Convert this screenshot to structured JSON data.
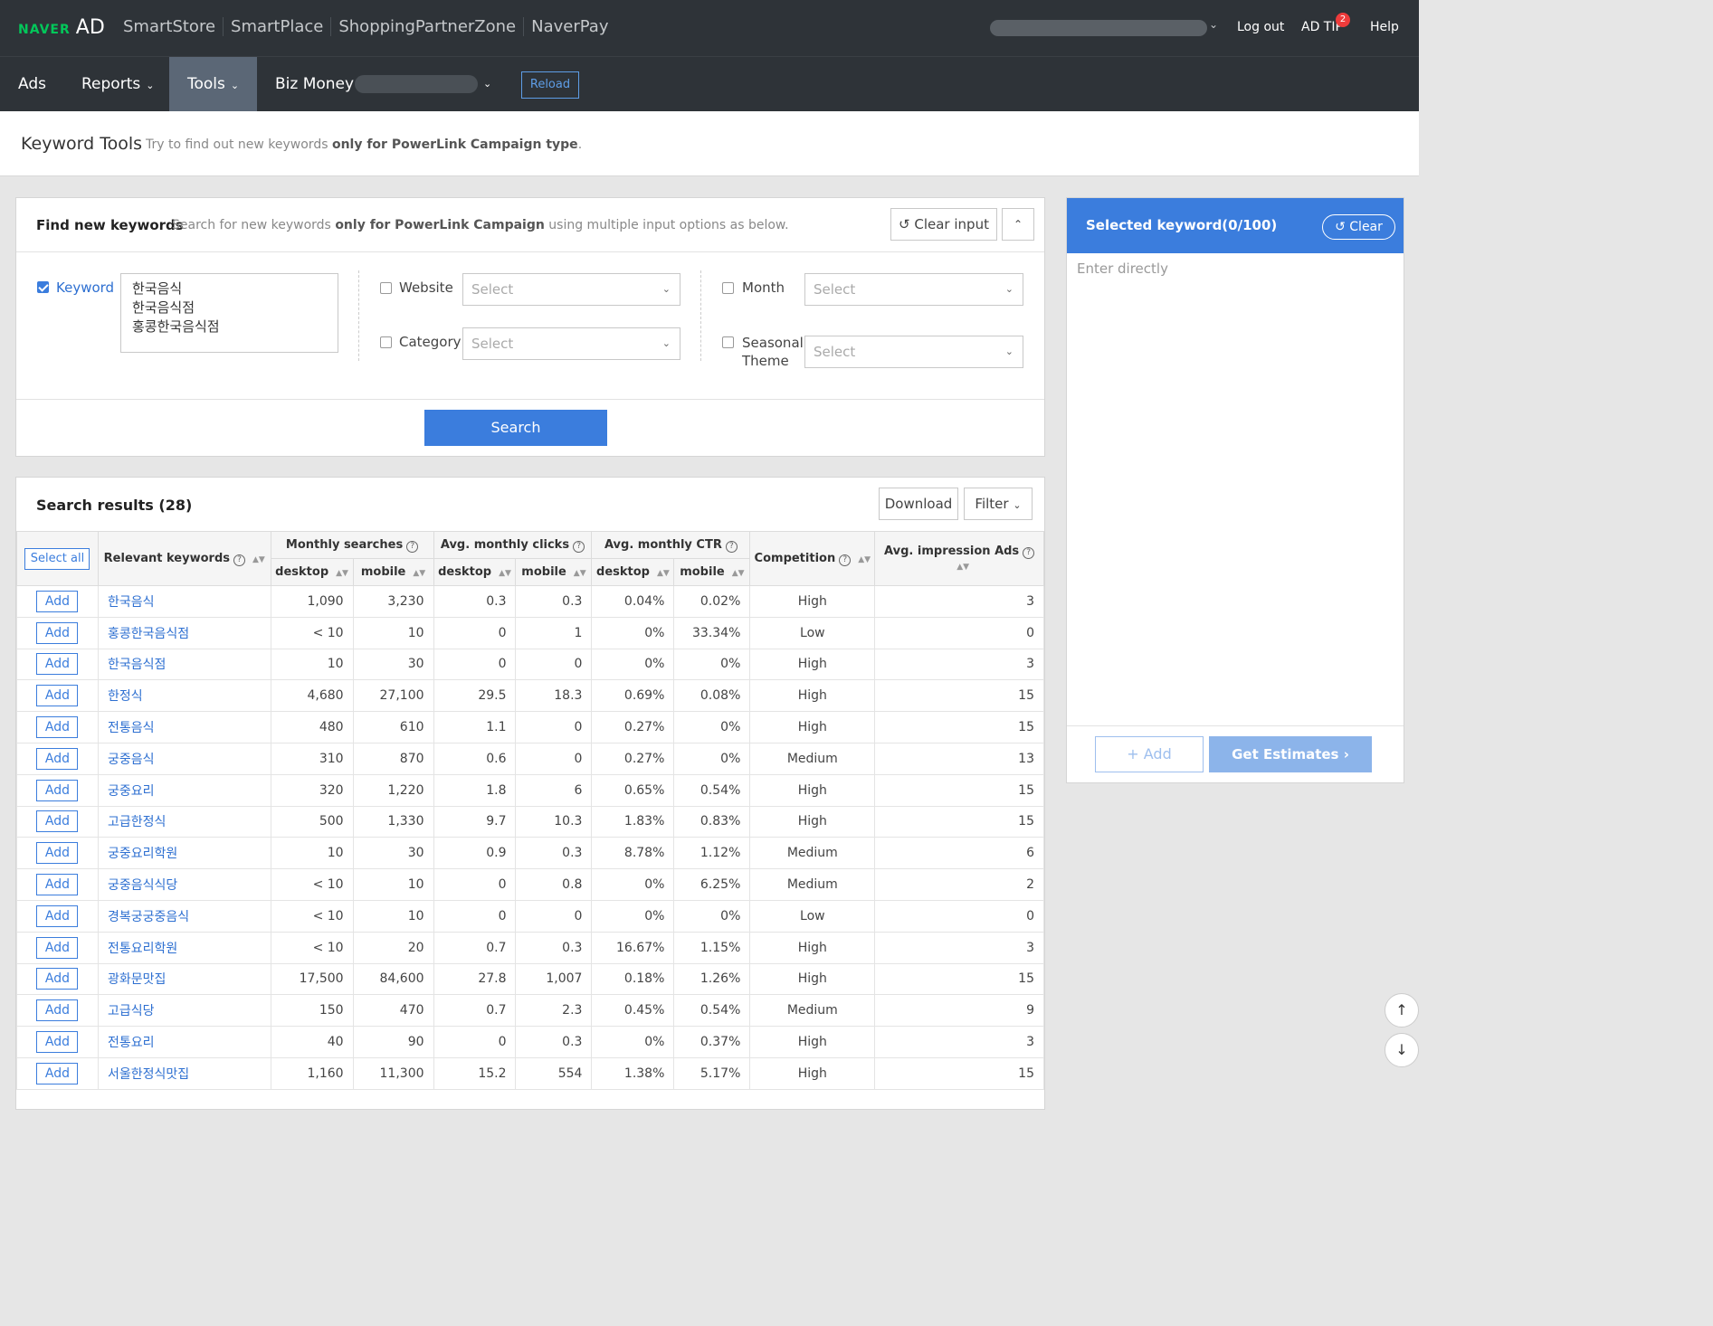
{
  "brand": {
    "naver": "NAVER",
    "ad": "AD"
  },
  "top_links": [
    "SmartStore",
    "SmartPlace",
    "ShoppingPartnerZone",
    "NaverPay"
  ],
  "top_right": {
    "logout": "Log out",
    "adtip": "AD TIP",
    "adtip_badge": "2",
    "help": "Help"
  },
  "nav": {
    "ads": "Ads",
    "reports": "Reports",
    "tools": "Tools",
    "bizmoney": "Biz Money",
    "reload": "Reload"
  },
  "page_title": {
    "title": "Keyword Tools",
    "desc_pre": "Try to find out new keywords ",
    "desc_bold": "only for PowerLink Campaign type",
    "desc_post": "."
  },
  "find": {
    "title": "Find new keywords",
    "desc_pre": "Search for new keywords ",
    "desc_bold": "only for PowerLink Campaign",
    "desc_post": " using multiple input options as below.",
    "clear_input": "Clear input",
    "keyword_label": "Keyword",
    "keyword_checked": true,
    "keywords": [
      "한국음식",
      "한국음식점",
      "홍콩한국음식점"
    ],
    "website_label": "Website",
    "category_label": "Category",
    "month_label": "Month",
    "seasonal_label_1": "Seasonal",
    "seasonal_label_2": "Theme",
    "select_placeholder": "Select",
    "search_button": "Search"
  },
  "results": {
    "title": "Search results (28)",
    "download": "Download",
    "filter": "Filter",
    "select_all": "Select all",
    "add_label": "Add",
    "headers": {
      "relevant": "Relevant keywords",
      "monthly": "Monthly searches",
      "clicks": "Avg. monthly clicks",
      "ctr": "Avg. monthly CTR",
      "competition": "Competition",
      "impression": "Avg. impression Ads",
      "desktop": "desktop",
      "mobile": "mobile"
    },
    "rows": [
      [
        "한국음식",
        "1,090",
        "3,230",
        "0.3",
        "0.3",
        "0.04%",
        "0.02%",
        "High",
        "3"
      ],
      [
        "홍콩한국음식점",
        "< 10",
        "10",
        "0",
        "1",
        "0%",
        "33.34%",
        "Low",
        "0"
      ],
      [
        "한국음식점",
        "10",
        "30",
        "0",
        "0",
        "0%",
        "0%",
        "High",
        "3"
      ],
      [
        "한정식",
        "4,680",
        "27,100",
        "29.5",
        "18.3",
        "0.69%",
        "0.08%",
        "High",
        "15"
      ],
      [
        "전통음식",
        "480",
        "610",
        "1.1",
        "0",
        "0.27%",
        "0%",
        "High",
        "15"
      ],
      [
        "궁중음식",
        "310",
        "870",
        "0.6",
        "0",
        "0.27%",
        "0%",
        "Medium",
        "13"
      ],
      [
        "궁중요리",
        "320",
        "1,220",
        "1.8",
        "6",
        "0.65%",
        "0.54%",
        "High",
        "15"
      ],
      [
        "고급한정식",
        "500",
        "1,330",
        "9.7",
        "10.3",
        "1.83%",
        "0.83%",
        "High",
        "15"
      ],
      [
        "궁중요리학원",
        "10",
        "30",
        "0.9",
        "0.3",
        "8.78%",
        "1.12%",
        "Medium",
        "6"
      ],
      [
        "궁중음식식당",
        "< 10",
        "10",
        "0",
        "0.8",
        "0%",
        "6.25%",
        "Medium",
        "2"
      ],
      [
        "경복궁궁중음식",
        "< 10",
        "10",
        "0",
        "0",
        "0%",
        "0%",
        "Low",
        "0"
      ],
      [
        "전통요리학원",
        "< 10",
        "20",
        "0.7",
        "0.3",
        "16.67%",
        "1.15%",
        "High",
        "3"
      ],
      [
        "광화문맛집",
        "17,500",
        "84,600",
        "27.8",
        "1,007",
        "0.18%",
        "1.26%",
        "High",
        "15"
      ],
      [
        "고급식당",
        "150",
        "470",
        "0.7",
        "2.3",
        "0.45%",
        "0.54%",
        "Medium",
        "9"
      ],
      [
        "전통요리",
        "40",
        "90",
        "0",
        "0.3",
        "0%",
        "0.37%",
        "High",
        "3"
      ],
      [
        "서울한정식맛집",
        "1,160",
        "11,300",
        "15.2",
        "554",
        "1.38%",
        "5.17%",
        "High",
        "15"
      ]
    ]
  },
  "selected": {
    "title": "Selected keyword(0/100)",
    "clear": "Clear",
    "placeholder": "Enter directly",
    "add": "Add",
    "estimates": "Get Estimates"
  },
  "colors": {
    "topbar": "#2e3338",
    "accent": "#3b7ddd",
    "active_nav": "#5b6776",
    "naver_green": "#03c75a"
  }
}
